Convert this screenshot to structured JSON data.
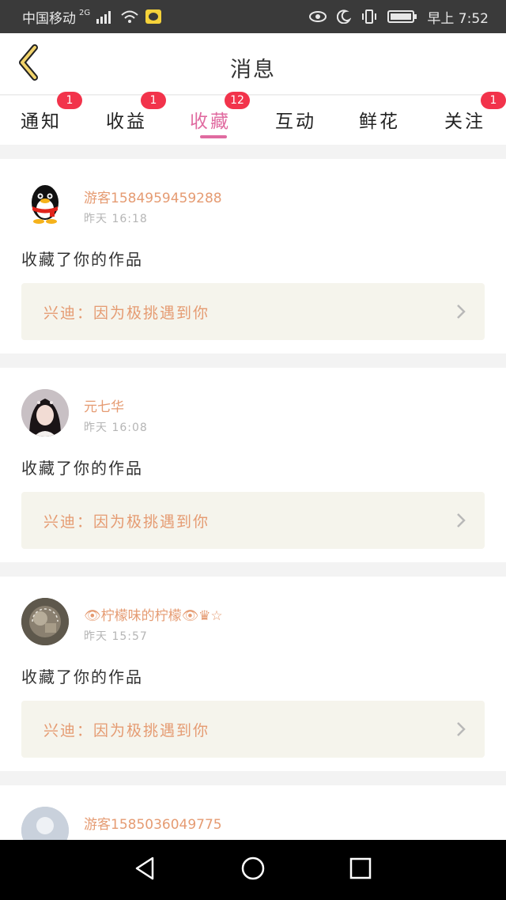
{
  "status_bar": {
    "carrier": "中国移动",
    "network": "2G",
    "time": "早上 7:52"
  },
  "header": {
    "title": "消息",
    "back_icon": "back-chevron-icon"
  },
  "tabs": [
    {
      "label": "通知",
      "badge": "1",
      "active": false
    },
    {
      "label": "收益",
      "badge": "1",
      "active": false
    },
    {
      "label": "收藏",
      "badge": "12",
      "active": true
    },
    {
      "label": "互动",
      "badge": "",
      "active": false
    },
    {
      "label": "鲜花",
      "badge": "",
      "active": false
    },
    {
      "label": "关注",
      "badge": "1",
      "active": false
    }
  ],
  "messages": [
    {
      "user": "游客1584959459288",
      "time": "昨天  16:18",
      "action": "收藏了你的作品",
      "work": "兴迪：因为极挑遇到你",
      "avatar": "penguin-avatar"
    },
    {
      "user": "元七华",
      "time": "昨天  16:08",
      "action": "收藏了你的作品",
      "work": "兴迪：因为极挑遇到你",
      "avatar": "portrait-avatar"
    },
    {
      "user": "👁柠檬味的柠檬👁♛☆",
      "time": "昨天  15:57",
      "action": "收藏了你的作品",
      "work": "兴迪：因为极挑遇到你",
      "avatar": "photo-avatar"
    },
    {
      "user": "游客1585036049775",
      "time": "",
      "action": "",
      "work": "",
      "avatar": "default-avatar"
    }
  ],
  "colors": {
    "accent": "#e06ba0",
    "badge": "#f2334b",
    "username": "#e59b72",
    "work_box_bg": "#f5f4ec"
  }
}
